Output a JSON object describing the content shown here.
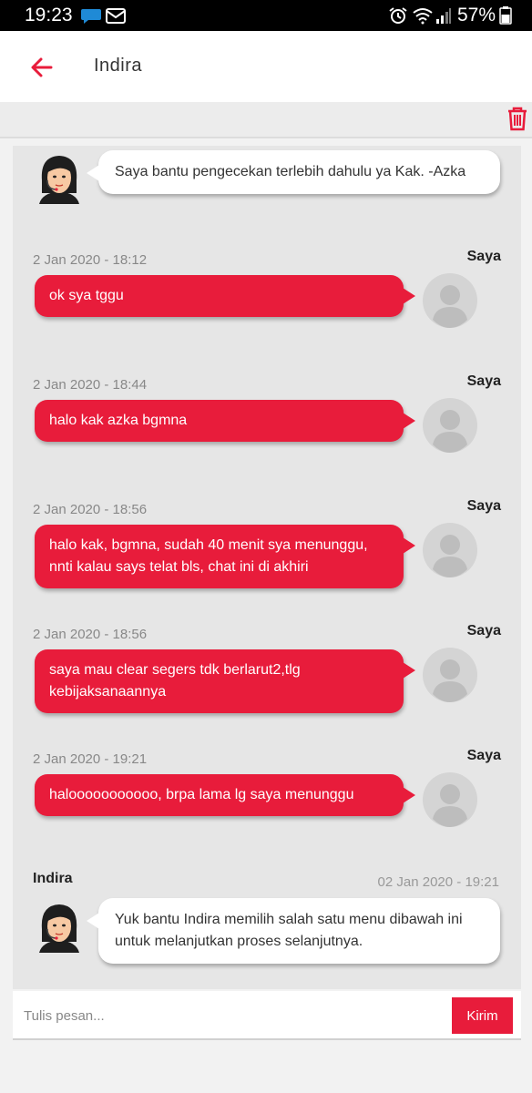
{
  "status_bar": {
    "time": "19:23",
    "battery": "57%",
    "left_icons": [
      "chat-notification-icon",
      "mail-notification-icon"
    ],
    "right_icons": [
      "alarm-icon",
      "wifi-icon",
      "signal-icon",
      "battery-icon"
    ]
  },
  "header": {
    "title": "Indira",
    "back_icon": "arrow-left-icon",
    "accent_color": "#e81c3b"
  },
  "toolbar": {
    "delete_icon": "trash-icon"
  },
  "chat": {
    "agent_intro": {
      "text": "Saya bantu pengecekan terlebih dahulu ya Kak. -Azka",
      "avatar_icon": "agent-avatar-icon"
    },
    "messages": [
      {
        "sender": "Saya",
        "timestamp": "2 Jan 2020 - 18:12",
        "text": "ok sya tggu"
      },
      {
        "sender": "Saya",
        "timestamp": "2 Jan 2020 - 18:44",
        "text": "halo kak azka bgmna"
      },
      {
        "sender": "Saya",
        "timestamp": "2 Jan 2020 - 18:56",
        "text": "halo kak, bgmna, sudah 40 menit sya menunggu, nnti kalau says telat bls, chat ini di akhiri"
      },
      {
        "sender": "Saya",
        "timestamp": "2 Jan 2020 - 18:56",
        "text": "saya mau clear segers tdk berlarut2,tlg kebijaksanaannya"
      },
      {
        "sender": "Saya",
        "timestamp": "2 Jan 2020 - 19:21",
        "text": "halooooooooooo, brpa lama lg saya menunggu"
      }
    ],
    "agent_last": {
      "sender": "Indira",
      "timestamp": "02 Jan 2020 - 19:21",
      "text": "Yuk bantu Indira memilih salah satu menu dibawah ini untuk melanjutkan proses selanjutnya."
    }
  },
  "composer": {
    "placeholder": "Tulis pesan...",
    "send_label": "Kirim"
  }
}
